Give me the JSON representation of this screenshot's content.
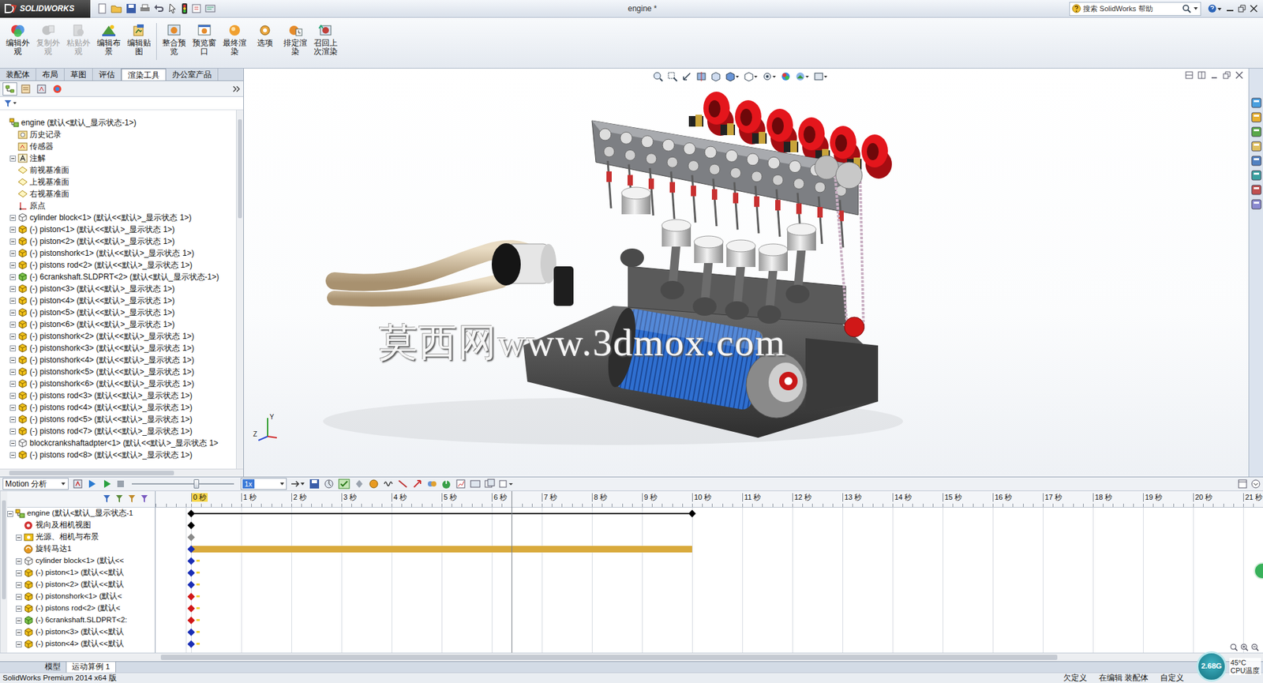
{
  "window": {
    "app": "SOLIDWORKS",
    "title": "engine *"
  },
  "search": {
    "placeholder": "搜索 SolidWorks 帮助"
  },
  "ribbon": [
    {
      "label": "编辑外观",
      "disabled": false
    },
    {
      "label": "复制外观",
      "disabled": true
    },
    {
      "label": "粘贴外观",
      "disabled": true
    },
    {
      "label": "编辑布景",
      "disabled": false
    },
    {
      "label": "编辑贴图",
      "disabled": false
    },
    {
      "label": "整合预览",
      "disabled": false
    },
    {
      "label": "预览窗口",
      "disabled": false
    },
    {
      "label": "最终渲染",
      "disabled": false
    },
    {
      "label": "选项",
      "disabled": false
    },
    {
      "label": "排定渲染",
      "disabled": false
    },
    {
      "label": "召回上次渲染",
      "disabled": false
    }
  ],
  "tabs": [
    {
      "label": "装配体",
      "selected": false
    },
    {
      "label": "布局",
      "selected": false
    },
    {
      "label": "草图",
      "selected": false
    },
    {
      "label": "评估",
      "selected": false
    },
    {
      "label": "渲染工具",
      "selected": true
    },
    {
      "label": "办公室产品",
      "selected": false
    }
  ],
  "panel_tabs": [
    {
      "selected": true
    },
    {
      "selected": false
    },
    {
      "selected": false
    },
    {
      "selected": false
    }
  ],
  "feature_tree": [
    {
      "label": "engine  (默认<默认_显示状态-1>)",
      "kind": "root",
      "expandable": false
    },
    {
      "label": "历史记录",
      "kind": "history",
      "expandable": false
    },
    {
      "label": "传感器",
      "kind": "sensor",
      "expandable": false
    },
    {
      "label": "注解",
      "kind": "annotation",
      "expandable": true
    },
    {
      "label": "前视基准面",
      "kind": "plane",
      "expandable": false
    },
    {
      "label": "上视基准面",
      "kind": "plane",
      "expandable": false
    },
    {
      "label": "右视基准面",
      "kind": "plane",
      "expandable": false
    },
    {
      "label": "原点",
      "kind": "origin",
      "expandable": false
    },
    {
      "label": "cylinder block<1> (默认<<默认>_显示状态 1>)",
      "kind": "fixed",
      "expandable": true
    },
    {
      "label": "(-) piston<1> (默认<<默认>_显示状态 1>)",
      "kind": "part",
      "expandable": true
    },
    {
      "label": "(-) piston<2> (默认<<默认>_显示状态 1>)",
      "kind": "part",
      "expandable": true
    },
    {
      "label": "(-) pistonshork<1> (默认<<默认>_显示状态 1>)",
      "kind": "part",
      "expandable": true
    },
    {
      "label": "(-) pistons rod<2> (默认<<默认>_显示状态 1>)",
      "kind": "part",
      "expandable": true
    },
    {
      "label": "(-) 6crankshaft.SLDPRT<2> (默认<默认_显示状态-1>)",
      "kind": "assembly",
      "expandable": true
    },
    {
      "label": "(-) piston<3> (默认<<默认>_显示状态 1>)",
      "kind": "part",
      "expandable": true
    },
    {
      "label": "(-) piston<4> (默认<<默认>_显示状态 1>)",
      "kind": "part",
      "expandable": true
    },
    {
      "label": "(-) piston<5> (默认<<默认>_显示状态 1>)",
      "kind": "part",
      "expandable": true
    },
    {
      "label": "(-) piston<6> (默认<<默认>_显示状态 1>)",
      "kind": "part",
      "expandable": true
    },
    {
      "label": "(-) pistonshork<2> (默认<<默认>_显示状态 1>)",
      "kind": "part",
      "expandable": true
    },
    {
      "label": "(-) pistonshork<3> (默认<<默认>_显示状态 1>)",
      "kind": "part",
      "expandable": true
    },
    {
      "label": "(-) pistonshork<4> (默认<<默认>_显示状态 1>)",
      "kind": "part",
      "expandable": true
    },
    {
      "label": "(-) pistonshork<5> (默认<<默认>_显示状态 1>)",
      "kind": "part",
      "expandable": true
    },
    {
      "label": "(-) pistonshork<6> (默认<<默认>_显示状态 1>)",
      "kind": "part",
      "expandable": true
    },
    {
      "label": "(-) pistons rod<3> (默认<<默认>_显示状态 1>)",
      "kind": "part",
      "expandable": true
    },
    {
      "label": "(-) pistons rod<4> (默认<<默认>_显示状态 1>)",
      "kind": "part",
      "expandable": true
    },
    {
      "label": "(-) pistons rod<5> (默认<<默认>_显示状态 1>)",
      "kind": "part",
      "expandable": true
    },
    {
      "label": "(-) pistons rod<7> (默认<<默认>_显示状态 1>)",
      "kind": "part",
      "expandable": true
    },
    {
      "label": "blockcrankshaftadpter<1> (默认<<默认>_显示状态 1>",
      "kind": "fixed",
      "expandable": true
    },
    {
      "label": "(-) pistons rod<8> (默认<<默认>_显示状态 1>)",
      "kind": "part",
      "expandable": true
    }
  ],
  "viewport": {
    "watermark": "莫西网www.3dmox.com",
    "axis_labels": [
      "Y",
      "Z"
    ]
  },
  "motion": {
    "study_type": "Motion 分析",
    "playback_level": 0.63,
    "speed": "1x",
    "playhead": 6.4,
    "ticks": [
      {
        "label": "0 秒",
        "selected": true
      },
      {
        "label": "1 秒",
        "selected": false
      },
      {
        "label": "2 秒",
        "selected": false
      },
      {
        "label": "3 秒",
        "selected": false
      },
      {
        "label": "4 秒",
        "selected": false
      },
      {
        "label": "5 秒",
        "selected": false
      },
      {
        "label": "6 秒",
        "selected": false
      },
      {
        "label": "7 秒",
        "selected": false
      },
      {
        "label": "8 秒",
        "selected": false
      },
      {
        "label": "9 秒",
        "selected": false
      },
      {
        "label": "10 秒",
        "selected": false
      },
      {
        "label": "11 秒",
        "selected": false
      },
      {
        "label": "12 秒",
        "selected": false
      },
      {
        "label": "13 秒",
        "selected": false
      },
      {
        "label": "14 秒",
        "selected": false
      },
      {
        "label": "15 秒",
        "selected": false
      },
      {
        "label": "16 秒",
        "selected": false
      },
      {
        "label": "17 秒",
        "selected": false
      },
      {
        "label": "18 秒",
        "selected": false
      },
      {
        "label": "19 秒",
        "selected": false
      },
      {
        "label": "20 秒",
        "selected": false
      },
      {
        "label": "21 秒",
        "selected": false
      }
    ],
    "rows": [
      {
        "label": "engine  (默认<默认_显示状态-1",
        "kind": "root",
        "indent": 0,
        "expandable": true,
        "expanded": true,
        "keys": [
          0,
          10
        ],
        "key_color": "#000000",
        "change_marks": false,
        "span": {
          "from": 0,
          "to": 10,
          "kind": "line",
          "color": "#000000"
        }
      },
      {
        "label": "视向及相机视图",
        "kind": "camera",
        "indent": 1,
        "expandable": false,
        "expanded": false,
        "keys": [
          0
        ],
        "key_color": "#000000",
        "change_marks": false,
        "span": null
      },
      {
        "label": "光源、相机与布景",
        "kind": "lights",
        "indent": 1,
        "expandable": true,
        "expanded": false,
        "keys": [
          0
        ],
        "key_color": "#8a8a8a",
        "change_marks": false,
        "span": null
      },
      {
        "label": "旋转马达1",
        "kind": "motor",
        "indent": 1,
        "expandable": false,
        "expanded": false,
        "keys": [
          0
        ],
        "key_color": "#1b2fb5",
        "change_marks": false,
        "span": {
          "from": 0,
          "to": 10,
          "kind": "bar",
          "color": "#d9aa3c"
        }
      },
      {
        "label": "cylinder block<1> (默认<<",
        "kind": "fixed",
        "indent": 1,
        "expandable": true,
        "expanded": false,
        "keys": [
          0
        ],
        "key_color": "#1b2fb5",
        "change_marks": true,
        "span": null
      },
      {
        "label": "(-) piston<1> (默认<<默认",
        "kind": "part",
        "indent": 1,
        "expandable": true,
        "expanded": false,
        "keys": [
          0
        ],
        "key_color": "#1b2fb5",
        "change_marks": true,
        "span": null
      },
      {
        "label": "(-) piston<2> (默认<<默认",
        "kind": "part",
        "indent": 1,
        "expandable": true,
        "expanded": false,
        "keys": [
          0
        ],
        "key_color": "#1b2fb5",
        "change_marks": true,
        "span": null
      },
      {
        "label": "(-) pistonshork<1> (默认<",
        "kind": "part",
        "indent": 1,
        "expandable": true,
        "expanded": false,
        "keys": [
          0
        ],
        "key_color": "#d01818",
        "change_marks": true,
        "span": null
      },
      {
        "label": "(-) pistons rod<2> (默认<",
        "kind": "part",
        "indent": 1,
        "expandable": true,
        "expanded": false,
        "keys": [
          0
        ],
        "key_color": "#d01818",
        "change_marks": true,
        "span": null
      },
      {
        "label": "(-) 6crankshaft.SLDPRT<2:",
        "kind": "assembly",
        "indent": 1,
        "expandable": true,
        "expanded": false,
        "keys": [
          0
        ],
        "key_color": "#d01818",
        "change_marks": true,
        "span": null
      },
      {
        "label": "(-) piston<3> (默认<<默认",
        "kind": "part",
        "indent": 1,
        "expandable": true,
        "expanded": false,
        "keys": [
          0
        ],
        "key_color": "#1b2fb5",
        "change_marks": true,
        "span": null
      },
      {
        "label": "(-) piston<4> (默认<<默认",
        "kind": "part",
        "indent": 1,
        "expandable": true,
        "expanded": false,
        "keys": [
          0
        ],
        "key_color": "#1b2fb5",
        "change_marks": true,
        "span": null
      }
    ]
  },
  "bottom_tabs": [
    {
      "label": "模型",
      "selected": false
    },
    {
      "label": "运动算例 1",
      "selected": true
    }
  ],
  "status_bar": [
    "SolidWorks Premium 2014 x64 版",
    "欠定义",
    "在编辑 装配体",
    "自定义"
  ],
  "cpu": {
    "frequency": "2.68G",
    "temperature": "45°C",
    "label": "CPU温度"
  }
}
